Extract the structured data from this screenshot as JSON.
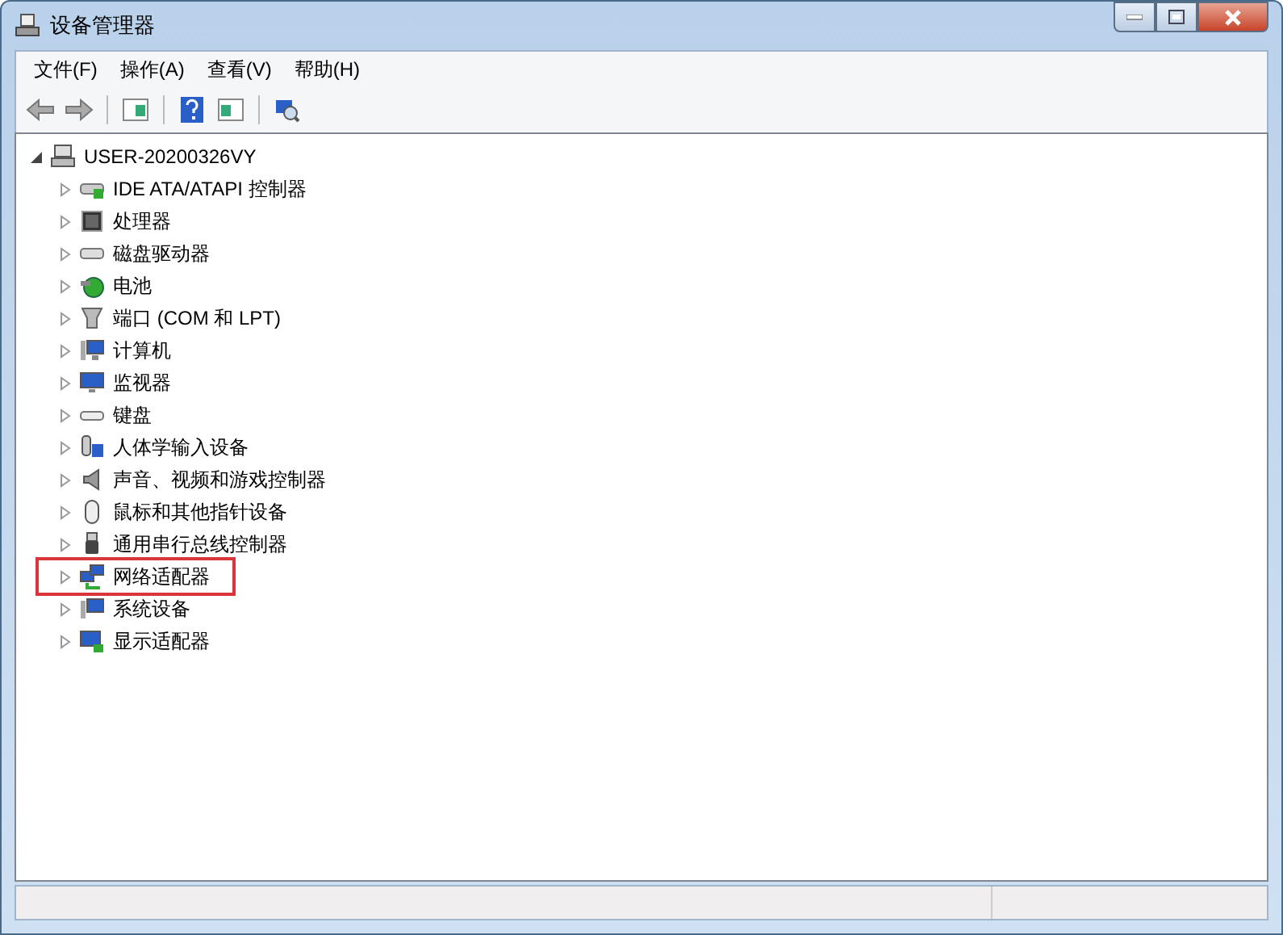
{
  "window": {
    "title": "设备管理器"
  },
  "menu": [
    "文件(F)",
    "操作(A)",
    "查看(V)",
    "帮助(H)"
  ],
  "tree": {
    "label": "USER-20200326VY",
    "expanded": true,
    "highlighted": false,
    "children": [
      {
        "label": "IDE ATA/ATAPI 控制器",
        "expanded": false,
        "highlighted": false
      },
      {
        "label": "处理器",
        "expanded": false,
        "highlighted": false
      },
      {
        "label": "磁盘驱动器",
        "expanded": false,
        "highlighted": false
      },
      {
        "label": "电池",
        "expanded": false,
        "highlighted": false
      },
      {
        "label": "端口 (COM 和 LPT)",
        "expanded": false,
        "highlighted": false
      },
      {
        "label": "计算机",
        "expanded": false,
        "highlighted": false
      },
      {
        "label": "监视器",
        "expanded": false,
        "highlighted": false
      },
      {
        "label": "键盘",
        "expanded": false,
        "highlighted": false
      },
      {
        "label": "人体学输入设备",
        "expanded": false,
        "highlighted": false
      },
      {
        "label": "声音、视频和游戏控制器",
        "expanded": false,
        "highlighted": false
      },
      {
        "label": "鼠标和其他指针设备",
        "expanded": false,
        "highlighted": false
      },
      {
        "label": "通用串行总线控制器",
        "expanded": false,
        "highlighted": false
      },
      {
        "label": "网络适配器",
        "expanded": false,
        "highlighted": true
      },
      {
        "label": "系统设备",
        "expanded": false,
        "highlighted": false
      },
      {
        "label": "显示适配器",
        "expanded": false,
        "highlighted": false
      }
    ]
  }
}
